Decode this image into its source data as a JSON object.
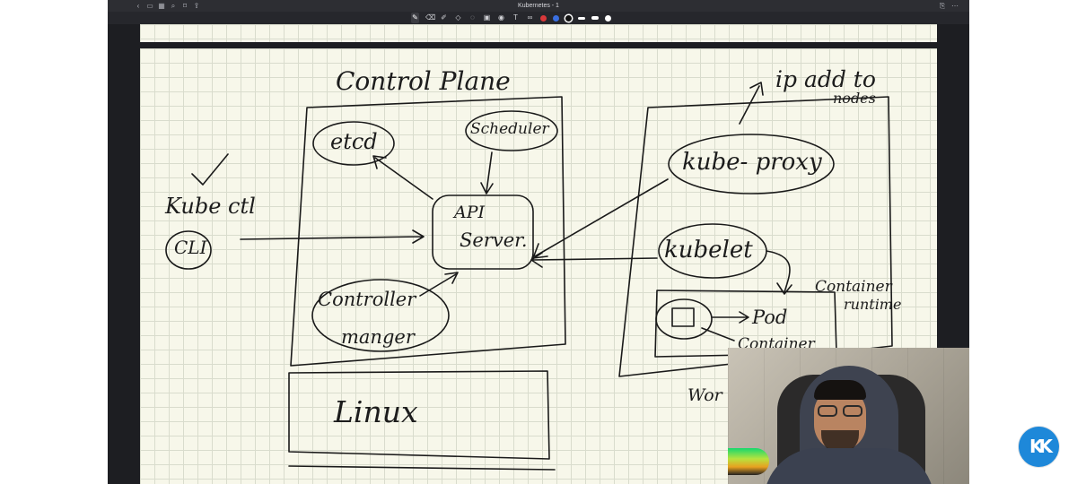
{
  "window": {
    "title": "Kubernetes - 1"
  },
  "nav_icons": [
    {
      "name": "back-icon",
      "glyph": "‹"
    },
    {
      "name": "sidebar-icon",
      "glyph": "▭"
    },
    {
      "name": "thumbnails-icon",
      "glyph": "▦"
    },
    {
      "name": "search-icon",
      "glyph": "⌕"
    },
    {
      "name": "bookmark-icon",
      "glyph": "⌑"
    },
    {
      "name": "share-icon",
      "glyph": "⇪"
    }
  ],
  "right_icons": [
    {
      "name": "export-icon",
      "glyph": "⎘"
    },
    {
      "name": "more-icon",
      "glyph": "⋯"
    }
  ],
  "tools": [
    {
      "name": "pen-tool-icon",
      "glyph": "✎",
      "active": true
    },
    {
      "name": "eraser-tool-icon",
      "glyph": "⌫",
      "active": false
    },
    {
      "name": "highlighter-tool-icon",
      "glyph": "✐",
      "active": false
    },
    {
      "name": "shapes-tool-icon",
      "glyph": "◇",
      "active": false
    },
    {
      "name": "lasso-tool-icon",
      "glyph": "◌",
      "active": false
    },
    {
      "name": "image-tool-icon",
      "glyph": "▣",
      "active": false
    },
    {
      "name": "eye-tool-icon",
      "glyph": "◉",
      "active": false
    },
    {
      "name": "text-tool-icon",
      "glyph": "T",
      "active": false
    },
    {
      "name": "link-tool-icon",
      "glyph": "∞",
      "active": false
    }
  ],
  "colors": {
    "red": "#d9383a",
    "blue": "#3a6fe0",
    "black": "#111111",
    "page": "#f7f7ea",
    "grid": "#d9dccd",
    "logo": "#1e88d9"
  },
  "notes": {
    "control_plane": "Control Plane",
    "etcd": "etcd",
    "scheduler": "Scheduler",
    "api_server_1": "API",
    "api_server_2": "Server.",
    "controller_1": "Controller",
    "controller_2": "manger",
    "kubectl": "Kube ctl",
    "cli": "CLI",
    "checkmark": "✓",
    "ip_add_1": "ip add to",
    "ip_add_2": "nodes",
    "kube_proxy": "kube- proxy",
    "kubelet": "kubelet",
    "container_runtime_1": "Container",
    "container_runtime_2": "runtime",
    "pod": "Pod",
    "container": "Container",
    "linux": "Linux",
    "worker": "Wor"
  },
  "logo": {
    "text": "KK"
  }
}
